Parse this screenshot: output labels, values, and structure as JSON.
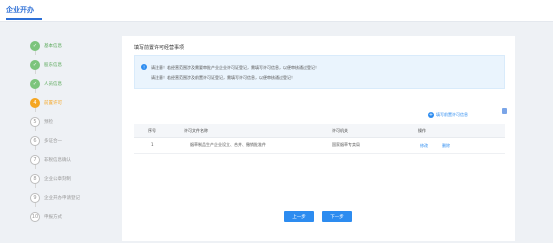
{
  "app": {
    "title": "企业开办"
  },
  "sidebar": {
    "steps": [
      {
        "num": "1",
        "label": "基本信息",
        "state": "done"
      },
      {
        "num": "2",
        "label": "股东信息",
        "state": "done"
      },
      {
        "num": "3",
        "label": "人员信息",
        "state": "done"
      },
      {
        "num": "4",
        "label": "前置许可",
        "state": "active"
      },
      {
        "num": "5",
        "label": "预检",
        "state": "pending"
      },
      {
        "num": "6",
        "label": "多证合一",
        "state": "pending"
      },
      {
        "num": "7",
        "label": "非税信息确认",
        "state": "pending"
      },
      {
        "num": "8",
        "label": "企业公章刻制",
        "state": "pending"
      },
      {
        "num": "9",
        "label": "企业开办申请登记",
        "state": "pending"
      },
      {
        "num": "10",
        "label": "申报方式",
        "state": "pending"
      }
    ]
  },
  "main": {
    "title": "填写前置许可经营事项",
    "notice": {
      "line1": "请注意！若经营范围涉及需要审批产业企业许可证登记，需填写许可信息，以便审核通过登记！",
      "line2": "请注意！若经营范围涉及前置许可证登记，需填写许可信息，以便审核通过登记！"
    },
    "add_link": "填写前置许可信息",
    "table": {
      "headers": [
        "序号",
        "许可文件名称",
        "许可机关",
        "操作"
      ],
      "rows": [
        {
          "no": "1",
          "name": "烟草制品生产企业设立、合并、撤销批准件",
          "authority": "国家烟草专卖局",
          "actions": [
            "修改",
            "删除"
          ]
        }
      ]
    },
    "buttons": {
      "prev": "上一步",
      "next": "下一步"
    }
  },
  "colors": {
    "accent": "#2d8cf0",
    "done": "#7cc47c",
    "active": "#f5a623"
  },
  "icons": {
    "notice": "info-icon",
    "add": "plus-circle-icon",
    "doc": "document-icon"
  }
}
